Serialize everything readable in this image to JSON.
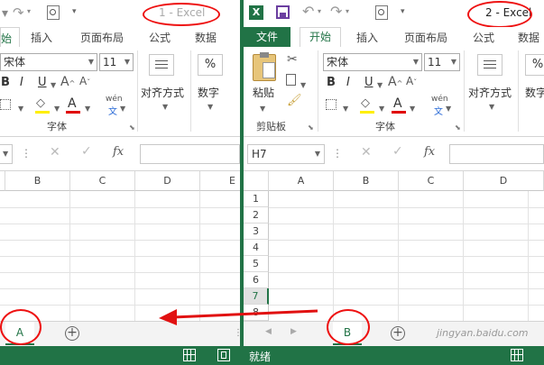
{
  "left_window": {
    "title": "1 - Excel",
    "tabs": [
      "始",
      "插入",
      "页面布局",
      "公式",
      "数据"
    ],
    "font_name": "宋体",
    "font_size": "11",
    "bold": "B",
    "italic": "I",
    "underline": "U",
    "wen": "wén",
    "wen_char": "文",
    "group_font": "字体",
    "align_label": "对齐方式",
    "number_label": "数字",
    "percent": "%",
    "fx": "fx",
    "columns": [
      "B",
      "C",
      "D",
      "E"
    ],
    "sheet_tab": "A"
  },
  "right_window": {
    "title": "2 - Excel",
    "excel_logo": "X",
    "tabs": [
      "文件",
      "开始",
      "插入",
      "页面布局",
      "公式",
      "数据"
    ],
    "active_tab": "开始",
    "paste_label": "粘贴",
    "clipboard_label": "剪贴板",
    "font_name": "宋体",
    "font_size": "11",
    "bold": "B",
    "italic": "I",
    "underline": "U",
    "wen": "wén",
    "wen_char": "文",
    "group_font": "字体",
    "align_label": "对齐方式",
    "number_label": "数字",
    "percent": "%",
    "name_box": "H7",
    "fx": "fx",
    "columns": [
      "A",
      "B",
      "C",
      "D"
    ],
    "rows": [
      "1",
      "2",
      "3",
      "4",
      "5",
      "6",
      "7",
      "8"
    ],
    "active_row": "7",
    "sheet_tab": "B",
    "status": "就绪",
    "watermark": "jingyan.baidu.com"
  },
  "colors": {
    "excel_green": "#217346",
    "annotation_red": "#e11111"
  }
}
